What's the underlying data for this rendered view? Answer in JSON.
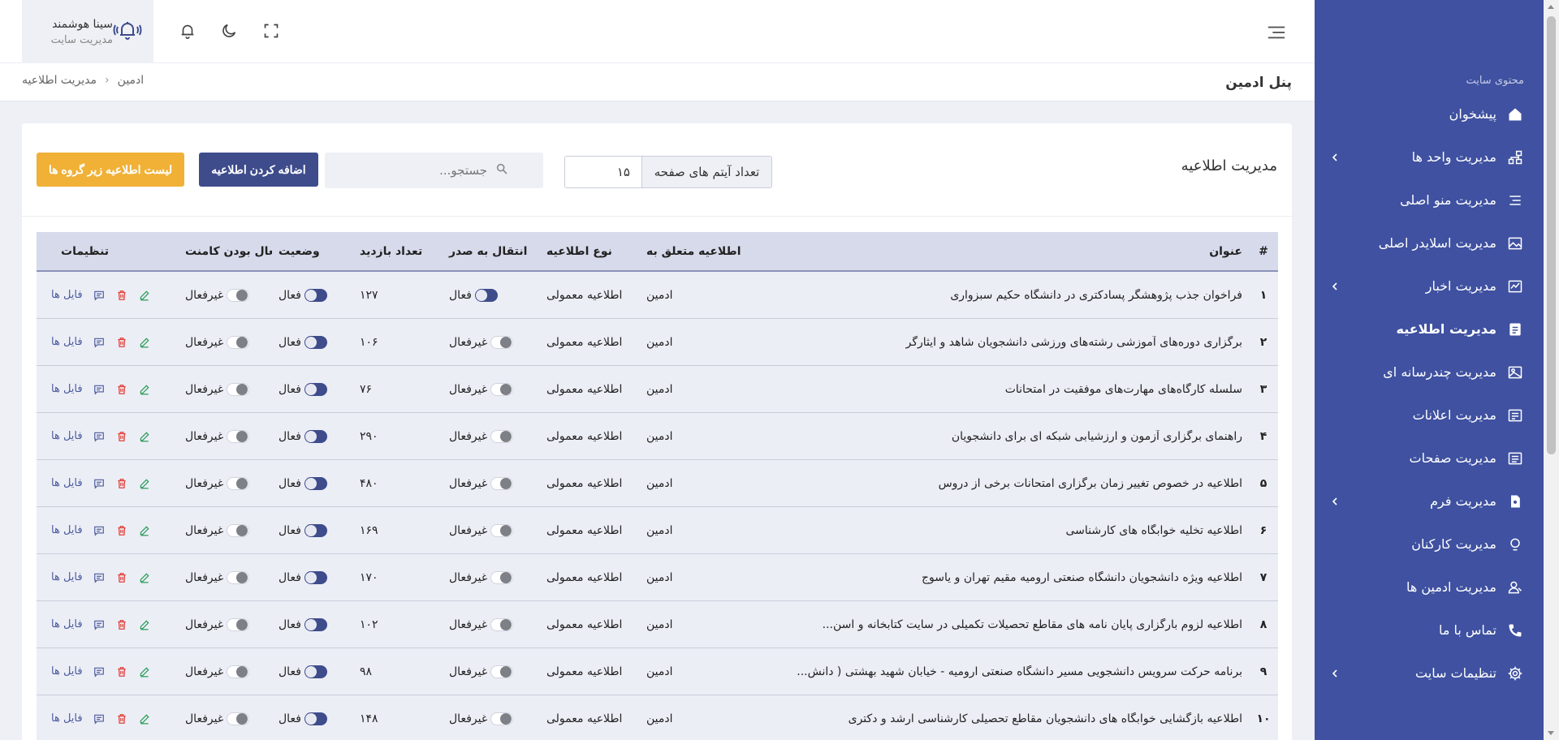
{
  "header": {
    "user_name": "سینا هوشمند",
    "user_role": "مدیریت سایت",
    "page_title": "پنل ادمین",
    "breadcrumb": [
      "ادمین",
      "مدیریت اطلاعیه"
    ]
  },
  "sidebar": {
    "section_title": "محتوی سایت",
    "items": [
      {
        "label": "پیشخوان",
        "icon": "home-icon",
        "has_children": false,
        "active": false
      },
      {
        "label": "مدیریت واحد ها",
        "icon": "sitemap-icon",
        "has_children": true,
        "active": false
      },
      {
        "label": "مدیریت منو اصلی",
        "icon": "menu-lines-icon",
        "has_children": false,
        "active": false
      },
      {
        "label": "مدیریت اسلایدر اصلی",
        "icon": "image-icon",
        "has_children": false,
        "active": false
      },
      {
        "label": "مدیریت اخبار",
        "icon": "chart-icon",
        "has_children": true,
        "active": false
      },
      {
        "label": "مدیریت اطلاعیه",
        "icon": "notice-icon",
        "has_children": false,
        "active": true
      },
      {
        "label": "مدیریت چندرسانه ای",
        "icon": "media-icon",
        "has_children": false,
        "active": false
      },
      {
        "label": "مدیریت اعلانات",
        "icon": "announce-icon",
        "has_children": false,
        "active": false
      },
      {
        "label": "مدیریت صفحات",
        "icon": "pages-icon",
        "has_children": false,
        "active": false
      },
      {
        "label": "مدیریت فرم",
        "icon": "form-icon",
        "has_children": true,
        "active": false
      },
      {
        "label": "مدیریت کارکنان",
        "icon": "user-circle-icon",
        "has_children": false,
        "active": false
      },
      {
        "label": "مدیریت ادمین ها",
        "icon": "admin-icon",
        "has_children": false,
        "active": false
      },
      {
        "label": "تماس با ما",
        "icon": "phone-icon",
        "has_children": false,
        "active": false
      },
      {
        "label": "تنظیمات سایت",
        "icon": "gear-icon",
        "has_children": true,
        "active": false
      }
    ]
  },
  "card": {
    "title": "مدیریت اطلاعیه",
    "per_page_label": "تعداد آیتم های صفحه",
    "per_page_value": "۱۵",
    "search_placeholder": "جستجو...",
    "add_button": "اضافه کردن اطلاعیه",
    "sub_list_button": "لیست اطلاعیه زیر گروه ها"
  },
  "table": {
    "headers": {
      "num": "#",
      "title": "عنوان",
      "owner": "اطلاعیه متعلق به",
      "type": "نوع اطلاعیه",
      "transfer": "انتقال به صدر",
      "visits": "تعداد بازدید",
      "status": "وضعیت",
      "comment": "فعال بودن کامنت",
      "settings": "تنظیمات"
    },
    "on_label": "فعال",
    "off_label": "غیرفعال",
    "files_label": "فایل ها",
    "rows": [
      {
        "num": "۱",
        "title": "فراخوان جذب پژوهشگر پسادکتری در دانشگاه حکیم سبزواری",
        "owner": "ادمین",
        "type": "اطلاعیه معمولی",
        "transfer": true,
        "visits": "۱۲۷",
        "status": true,
        "comment": false
      },
      {
        "num": "۲",
        "title": "برگزاری دوره‌های آموزشی رشته‌های ورزشی دانشجویان شاهد و ایثارگر",
        "owner": "ادمین",
        "type": "اطلاعیه معمولی",
        "transfer": false,
        "visits": "۱۰۶",
        "status": true,
        "comment": false
      },
      {
        "num": "۳",
        "title": "سلسله کارگاه‌های مهارت‌های موفقیت در امتحانات",
        "owner": "ادمین",
        "type": "اطلاعیه معمولی",
        "transfer": false,
        "visits": "۷۶",
        "status": true,
        "comment": false
      },
      {
        "num": "۴",
        "title": "راهنمای برگزاری آزمون و ارزشیابی شبکه ای برای دانشجویان",
        "owner": "ادمین",
        "type": "اطلاعیه معمولی",
        "transfer": false,
        "visits": "۲۹۰",
        "status": true,
        "comment": false
      },
      {
        "num": "۵",
        "title": "اطلاعیه در خصوص تغییر زمان برگزاری امتحانات برخی از دروس",
        "owner": "ادمین",
        "type": "اطلاعیه معمولی",
        "transfer": false,
        "visits": "۴۸۰",
        "status": true,
        "comment": false
      },
      {
        "num": "۶",
        "title": "اطلاعیه تخلیه خوابگاه های کارشناسی",
        "owner": "ادمین",
        "type": "اطلاعیه معمولی",
        "transfer": false,
        "visits": "۱۶۹",
        "status": true,
        "comment": false
      },
      {
        "num": "۷",
        "title": "اطلاعیه ویژه دانشجویان دانشگاه صنعتی ارومیه مقیم تهران و یاسوج",
        "owner": "ادمین",
        "type": "اطلاعیه معمولی",
        "transfer": false,
        "visits": "۱۷۰",
        "status": true,
        "comment": false
      },
      {
        "num": "۸",
        "title": "اطلاعیه لزوم بارگزاری پایان نامه های مقاطع تحصیلات تکمیلی در سایت کتابخانه و اسن...",
        "owner": "ادمین",
        "type": "اطلاعیه معمولی",
        "transfer": false,
        "visits": "۱۰۲",
        "status": true,
        "comment": false
      },
      {
        "num": "۹",
        "title": "برنامه حرکت سرویس دانشجویی مسیر دانشگاه صنعتی ارومیه - خیابان شهید بهشتی ( دانش...",
        "owner": "ادمین",
        "type": "اطلاعیه معمولی",
        "transfer": false,
        "visits": "۹۸",
        "status": true,
        "comment": false
      },
      {
        "num": "۱۰",
        "title": "اطلاعیه بازگشایی خوابگاه های دانشجویان مقاطع تحصیلی کارشناسی ارشد و دکتری",
        "owner": "ادمین",
        "type": "اطلاعیه معمولی",
        "transfer": false,
        "visits": "۱۴۸",
        "status": true,
        "comment": false
      }
    ]
  },
  "colors": {
    "sidebar_bg": "#3f51a0",
    "primary": "#3e4c8c",
    "warning": "#f0b136",
    "edit": "#2e9e5b",
    "delete": "#e0413a"
  }
}
